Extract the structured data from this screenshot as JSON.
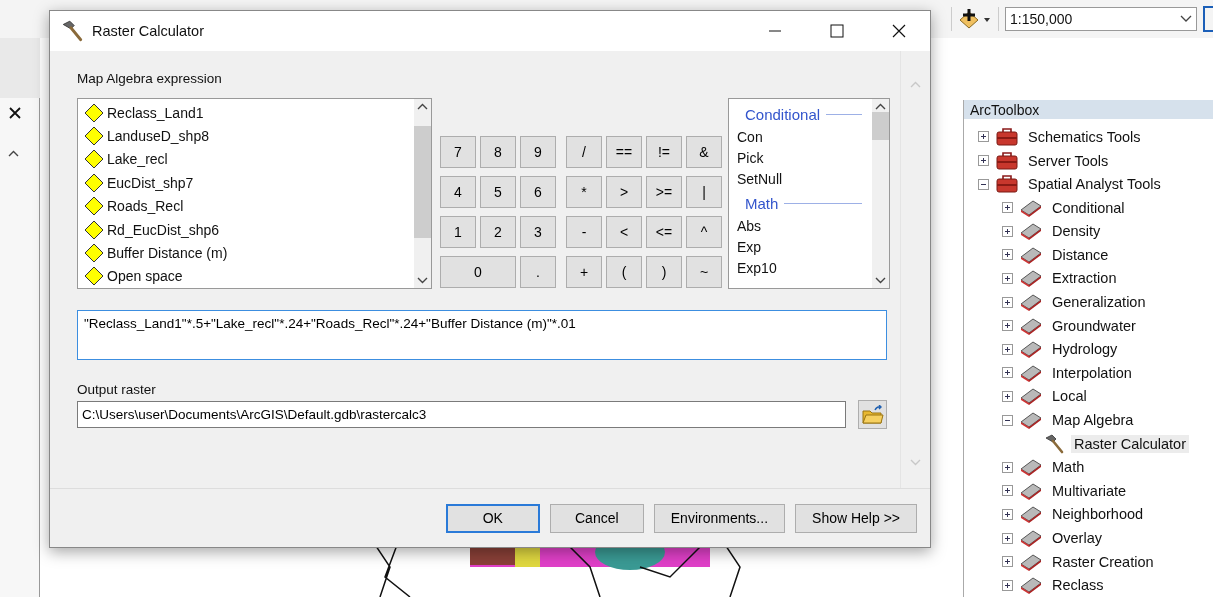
{
  "app": {
    "scale": "1:150,000"
  },
  "dialog": {
    "title": "Raster Calculator",
    "expression_label": "Map Algebra expression",
    "layers": [
      "Reclass_Land1",
      "LanduseD_shp8",
      "Lake_recl",
      "EucDist_shp7",
      "Roads_Recl",
      "Rd_EucDist_shp6",
      "Buffer Distance (m)",
      "Open space"
    ],
    "digits": [
      {
        "label": "7",
        "wide": false
      },
      {
        "label": "8",
        "wide": false
      },
      {
        "label": "9",
        "wide": false
      },
      {
        "label": "4",
        "wide": false
      },
      {
        "label": "5",
        "wide": false
      },
      {
        "label": "6",
        "wide": false
      },
      {
        "label": "1",
        "wide": false
      },
      {
        "label": "2",
        "wide": false
      },
      {
        "label": "3",
        "wide": false
      },
      {
        "label": "0",
        "wide": true
      },
      {
        "label": ".",
        "wide": false
      }
    ],
    "operators": [
      "/",
      "==",
      "!=",
      "&",
      "*",
      ">",
      ">=",
      "|",
      "-",
      "<",
      "<=",
      "^",
      "+",
      "(",
      ")",
      "~"
    ],
    "functions": [
      {
        "kind": "heading",
        "label": "Conditional"
      },
      {
        "kind": "item",
        "label": "Con"
      },
      {
        "kind": "item",
        "label": "Pick"
      },
      {
        "kind": "item",
        "label": "SetNull"
      },
      {
        "kind": "heading",
        "label": "Math"
      },
      {
        "kind": "item",
        "label": "Abs"
      },
      {
        "kind": "item",
        "label": "Exp"
      },
      {
        "kind": "item",
        "label": "Exp10"
      }
    ],
    "expression": "\"Reclass_Land1\"*.5+\"Lake_recl\"*.24+\"Roads_Recl\"*.24+\"Buffer Distance (m)\"*.01",
    "output_label": "Output raster",
    "output_value": "C:\\Users\\user\\Documents\\ArcGIS\\Default.gdb\\rastercalc3",
    "buttons": [
      {
        "label": "OK",
        "default": true
      },
      {
        "label": "Cancel",
        "default": false
      },
      {
        "label": "Environments...",
        "default": false
      },
      {
        "label": "Show Help >>",
        "default": false
      }
    ]
  },
  "toolbox": {
    "title": "ArcToolbox",
    "items": [
      {
        "label": "Schematics Tools",
        "kind": "toolbox",
        "expanded": false,
        "selected": false
      },
      {
        "label": "Server Tools",
        "kind": "toolbox",
        "expanded": false,
        "selected": false
      },
      {
        "label": "Spatial Analyst Tools",
        "kind": "toolbox",
        "expanded": true,
        "selected": false,
        "children": [
          {
            "label": "Conditional",
            "kind": "toolset",
            "expanded": false,
            "selected": false
          },
          {
            "label": "Density",
            "kind": "toolset",
            "expanded": false,
            "selected": false
          },
          {
            "label": "Distance",
            "kind": "toolset",
            "expanded": false,
            "selected": false
          },
          {
            "label": "Extraction",
            "kind": "toolset",
            "expanded": false,
            "selected": false
          },
          {
            "label": "Generalization",
            "kind": "toolset",
            "expanded": false,
            "selected": false
          },
          {
            "label": "Groundwater",
            "kind": "toolset",
            "expanded": false,
            "selected": false
          },
          {
            "label": "Hydrology",
            "kind": "toolset",
            "expanded": false,
            "selected": false
          },
          {
            "label": "Interpolation",
            "kind": "toolset",
            "expanded": false,
            "selected": false
          },
          {
            "label": "Local",
            "kind": "toolset",
            "expanded": false,
            "selected": false
          },
          {
            "label": "Map Algebra",
            "kind": "toolset",
            "expanded": true,
            "selected": false,
            "children": [
              {
                "label": "Raster Calculator",
                "kind": "tool",
                "selected": true
              }
            ]
          },
          {
            "label": "Math",
            "kind": "toolset",
            "expanded": false,
            "selected": false
          },
          {
            "label": "Multivariate",
            "kind": "toolset",
            "expanded": false,
            "selected": false
          },
          {
            "label": "Neighborhood",
            "kind": "toolset",
            "expanded": false,
            "selected": false
          },
          {
            "label": "Overlay",
            "kind": "toolset",
            "expanded": false,
            "selected": false
          },
          {
            "label": "Raster Creation",
            "kind": "toolset",
            "expanded": false,
            "selected": false
          },
          {
            "label": "Reclass",
            "kind": "toolset",
            "expanded": false,
            "selected": false
          }
        ]
      }
    ]
  }
}
